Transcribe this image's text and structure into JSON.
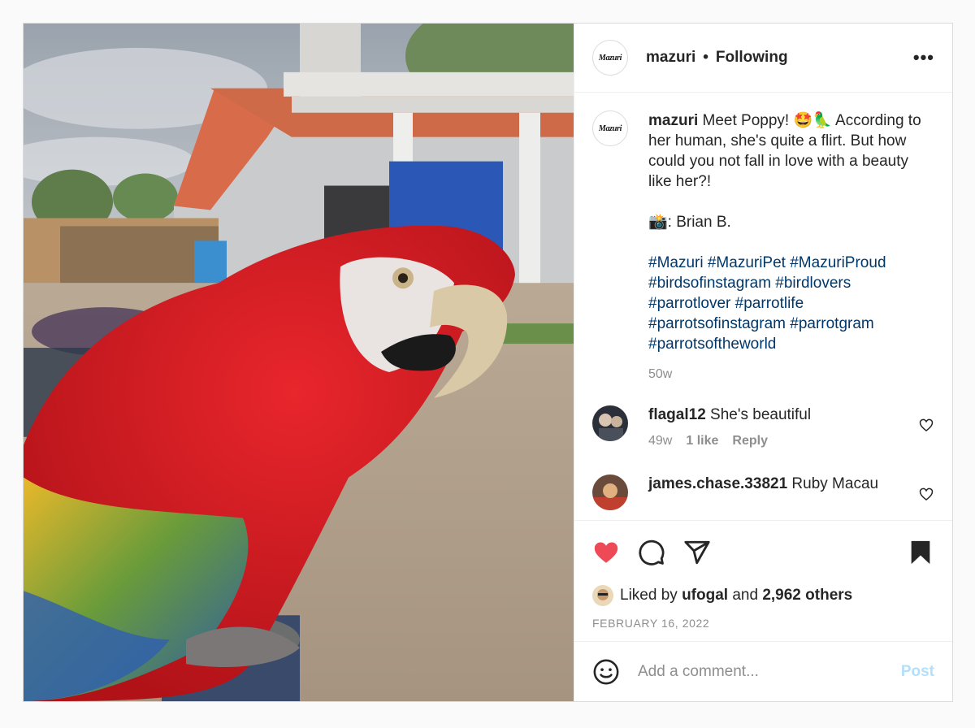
{
  "post": {
    "username": "mazuri",
    "avatar_text": "Mazuri",
    "separator": "•",
    "follow_status": "Following",
    "more_icon": "more-horizontal-icon",
    "caption": {
      "username": "mazuri",
      "line1": "Meet Poppy! 🤩🦜 According to her human, she's quite a flirt. But how could you not fall in love with a beauty like her?!",
      "photographer": "📸: Brian B.",
      "hashtags": "#Mazuri #MazuriPet #MazuriProud #birdsofinstagram #birdlovers #parrotlover #parrotlife #parrotsofinstagram #parrotgram #parrotsoftheworld",
      "age": "50w"
    },
    "comments": [
      {
        "username": "flagal12",
        "text": "She's beautiful",
        "age": "49w",
        "likes": "1 like",
        "reply": "Reply"
      },
      {
        "username": "james.chase.33821",
        "text": "Ruby Macau"
      }
    ],
    "likes": {
      "prefix": "Liked by",
      "user": "ufogal",
      "and": "and",
      "others": "2,962 others"
    },
    "date": "FEBRUARY 16, 2022",
    "add_comment": {
      "placeholder": "Add a comment...",
      "post_label": "Post"
    },
    "colors": {
      "like_red": "#ed4956",
      "hashtag": "#00376b",
      "post_disabled": "#b2dffc",
      "muted": "#8e8e8e"
    }
  }
}
